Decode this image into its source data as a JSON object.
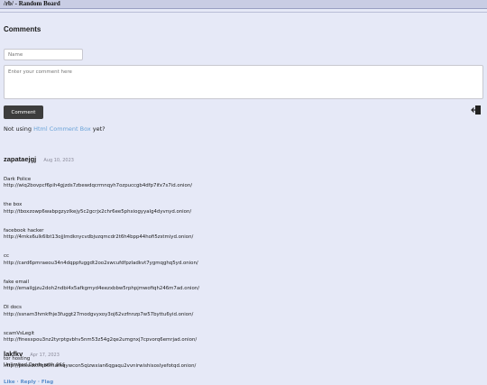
{
  "board": {
    "title": "/rb/ - Random Board"
  },
  "section": {
    "title": "Comments"
  },
  "form": {
    "name_placeholder": "Name",
    "comment_placeholder": "Enter your comment here",
    "submit_label": "Comment"
  },
  "promo": {
    "prefix": "Not using ",
    "link": "Html Comment Box",
    "suffix": "  yet?"
  },
  "comments": [
    {
      "author": "zapataejgj",
      "date": "Aug 10, 2023",
      "body": [
        {
          "title": "Dark Police",
          "url": "http://wiq2bovpcf6pih4gjzds7zbewdqcrmnqyh7ozpuccgb4dfp7ifx7s7id.onion/"
        },
        {
          "title": "the box",
          "url": "http://tboxzowp6wabpgzyzlkejy5c2gcrjx2chr6ee5phxiogyyalg4dyvnyd.onion/"
        },
        {
          "title": "facebook hacker",
          "url": "http://4mkx6ulk6lbt13ojjlmdknycvdbjvzqmcdr2t6h4bpp44hofi5zstmiyd.onion/"
        },
        {
          "title": "cc",
          "url": "http://card6pmraeou34n4dqppfuggdt2oo2swcufdfpzladkvt7ygmqghq5yd.onion/"
        },
        {
          "title": "fake email",
          "url": "http://emailgjzu2doh2ndbi4x5afkgmyd4eezxbbw5rphpjmwofiqh246m7ad.onion/"
        },
        {
          "title": "DI docs",
          "url": "http://ssnam3hmkfhje3fuggt27modgvyxoy3oj62vzfnnzp7w57byttu6yid.onion/"
        },
        {
          "title": "scamVsLegit",
          "url": "http://finesxpou3nz2tyrptgvbhv5nm53z54g2qe2umgnxj7cpvorq6emrjad.onion/"
        },
        {
          "title": "tor hosting",
          "url": "http://pxswbxtfqb6mafhqywcon5qizwxian6qgaqu2vvnirwishisoslyefotqd.onion/"
        }
      ],
      "actions": [
        "Like",
        "Reply",
        "Flag"
      ]
    },
    {
      "author": "lakfkv",
      "date": "Apr 17, 2023",
      "body": [
        {
          "title": "Unlimited Cards with $$$",
          "url": ""
        }
      ],
      "actions": []
    }
  ]
}
